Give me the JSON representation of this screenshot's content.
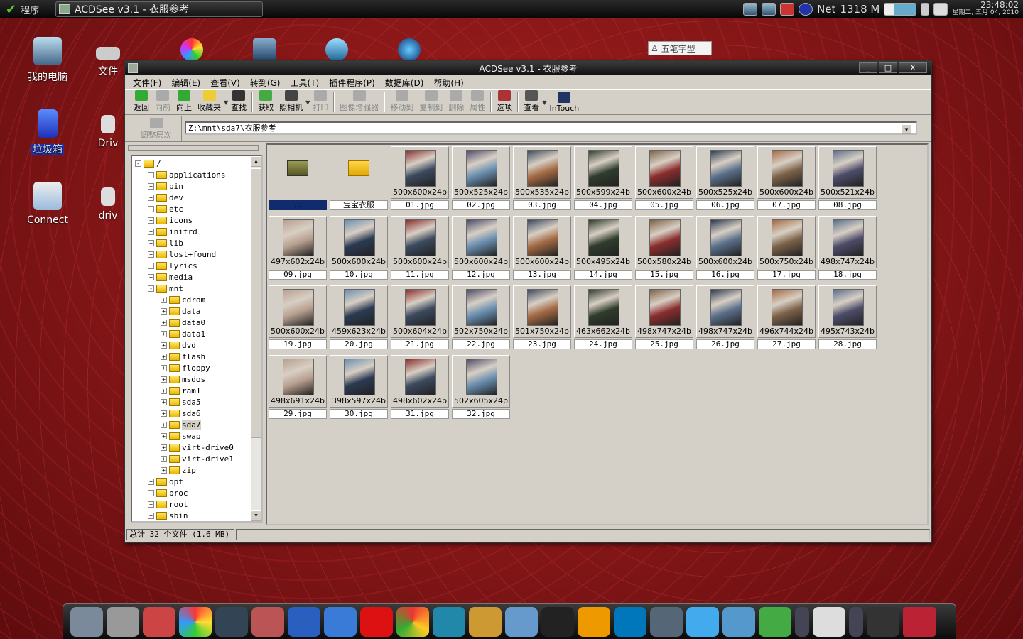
{
  "topbar": {
    "start_label": "程序",
    "task_title": "ACDSee v3.1 - 衣服参考",
    "net_label": "Net",
    "mem_label": "1318 M",
    "clock_time": "23:48:02",
    "clock_date": "星期二, 五月 04, 2010"
  },
  "desktop": {
    "items": [
      {
        "label": "我的电脑"
      },
      {
        "label": "文件"
      },
      {
        "label": "垃圾箱"
      },
      {
        "label": "Driv"
      },
      {
        "label": "Connect"
      },
      {
        "label": "driv"
      }
    ],
    "ime_label": "五笔字型"
  },
  "window": {
    "title": "ACDSee v3.1 - 衣服参考",
    "controls": [
      "_",
      "□",
      "X"
    ],
    "menus": [
      "文件(F)",
      "编辑(E)",
      "查看(V)",
      "转到(G)",
      "工具(T)",
      "插件程序(P)",
      "数据库(D)",
      "帮助(H)"
    ],
    "toolbar": [
      "返回",
      "向前",
      "向上",
      "收藏夹",
      "查找",
      "获取",
      "照相机",
      "打印",
      "图像增强器",
      "移动到",
      "复制到",
      "删除",
      "属性",
      "选项",
      "查看",
      "InTouch"
    ],
    "updir_label": "调整层次",
    "address": "Z:\\mnt\\sda7\\衣服参考",
    "tree": [
      {
        "label": "/",
        "expand": "-"
      },
      {
        "label": "applications",
        "expand": "+"
      },
      {
        "label": "bin",
        "expand": "+"
      },
      {
        "label": "dev",
        "expand": "+"
      },
      {
        "label": "etc",
        "expand": "+"
      },
      {
        "label": "icons",
        "expand": "+"
      },
      {
        "label": "initrd",
        "expand": "+"
      },
      {
        "label": "lib",
        "expand": "+"
      },
      {
        "label": "lost+found",
        "expand": "+"
      },
      {
        "label": "lyrics",
        "expand": "+"
      },
      {
        "label": "media",
        "expand": "+"
      },
      {
        "label": "mnt",
        "expand": "-"
      },
      {
        "label": "cdrom",
        "expand": "+"
      },
      {
        "label": "data",
        "expand": "+"
      },
      {
        "label": "data0",
        "expand": "+"
      },
      {
        "label": "data1",
        "expand": "+"
      },
      {
        "label": "dvd",
        "expand": "+"
      },
      {
        "label": "flash",
        "expand": "+"
      },
      {
        "label": "floppy",
        "expand": "+"
      },
      {
        "label": "msdos",
        "expand": "+"
      },
      {
        "label": "ram1",
        "expand": "+"
      },
      {
        "label": "sda5",
        "expand": "+"
      },
      {
        "label": "sda6",
        "expand": "+"
      },
      {
        "label": "sda7",
        "expand": "+"
      },
      {
        "label": "swap",
        "expand": "+"
      },
      {
        "label": "virt-drive0",
        "expand": "+"
      },
      {
        "label": "virt-drive1",
        "expand": "+"
      },
      {
        "label": "zip",
        "expand": "+"
      },
      {
        "label": "opt",
        "expand": "+"
      },
      {
        "label": "proc",
        "expand": "+"
      },
      {
        "label": "root",
        "expand": "+"
      },
      {
        "label": "sbin",
        "expand": "+"
      }
    ],
    "folders": [
      {
        "name": ".."
      },
      {
        "name": "宝宝衣服"
      }
    ],
    "files": [
      {
        "name": "01.jpg",
        "dims": "500x600x24b"
      },
      {
        "name": "02.jpg",
        "dims": "500x525x24b"
      },
      {
        "name": "03.jpg",
        "dims": "500x535x24b"
      },
      {
        "name": "04.jpg",
        "dims": "500x599x24b"
      },
      {
        "name": "05.jpg",
        "dims": "500x600x24b"
      },
      {
        "name": "06.jpg",
        "dims": "500x525x24b"
      },
      {
        "name": "07.jpg",
        "dims": "500x600x24b"
      },
      {
        "name": "08.jpg",
        "dims": "500x521x24b"
      },
      {
        "name": "09.jpg",
        "dims": "497x602x24b"
      },
      {
        "name": "10.jpg",
        "dims": "500x600x24b"
      },
      {
        "name": "11.jpg",
        "dims": "500x600x24b"
      },
      {
        "name": "12.jpg",
        "dims": "500x600x24b"
      },
      {
        "name": "13.jpg",
        "dims": "500x600x24b"
      },
      {
        "name": "14.jpg",
        "dims": "500x495x24b"
      },
      {
        "name": "15.jpg",
        "dims": "500x580x24b"
      },
      {
        "name": "16.jpg",
        "dims": "500x600x24b"
      },
      {
        "name": "17.jpg",
        "dims": "500x750x24b"
      },
      {
        "name": "18.jpg",
        "dims": "498x747x24b"
      },
      {
        "name": "19.jpg",
        "dims": "500x600x24b"
      },
      {
        "name": "20.jpg",
        "dims": "459x623x24b"
      },
      {
        "name": "21.jpg",
        "dims": "500x604x24b"
      },
      {
        "name": "22.jpg",
        "dims": "502x750x24b"
      },
      {
        "name": "23.jpg",
        "dims": "501x750x24b"
      },
      {
        "name": "24.jpg",
        "dims": "463x662x24b"
      },
      {
        "name": "25.jpg",
        "dims": "498x747x24b"
      },
      {
        "name": "26.jpg",
        "dims": "498x747x24b"
      },
      {
        "name": "27.jpg",
        "dims": "496x744x24b"
      },
      {
        "name": "28.jpg",
        "dims": "495x743x24b"
      },
      {
        "name": "29.jpg",
        "dims": "498x691x24b"
      },
      {
        "name": "30.jpg",
        "dims": "398x597x24b"
      },
      {
        "name": "31.jpg",
        "dims": "498x602x24b"
      },
      {
        "name": "32.jpg",
        "dims": "502x605x24b"
      }
    ],
    "status": "总计 32 个文件 (1.6 MB)"
  },
  "dock": {
    "icons": [
      "monitor-icon",
      "camera-icon",
      "network-icon",
      "color-wheel-icon",
      "paint-icon",
      "pen-icon",
      "word-icon",
      "globe-icon",
      "opera-icon",
      "chrome-icon",
      "browser-icon",
      "rabbit-icon",
      "users-icon",
      "qq-icon",
      "headphones-icon",
      "k-player-icon",
      "media-play-icon",
      "chat-icon",
      "home-folder-icon",
      "download-icon",
      "arrows-icon",
      "speech-icon",
      "arrows-icon",
      "power-icon",
      "workspace-icon"
    ]
  }
}
